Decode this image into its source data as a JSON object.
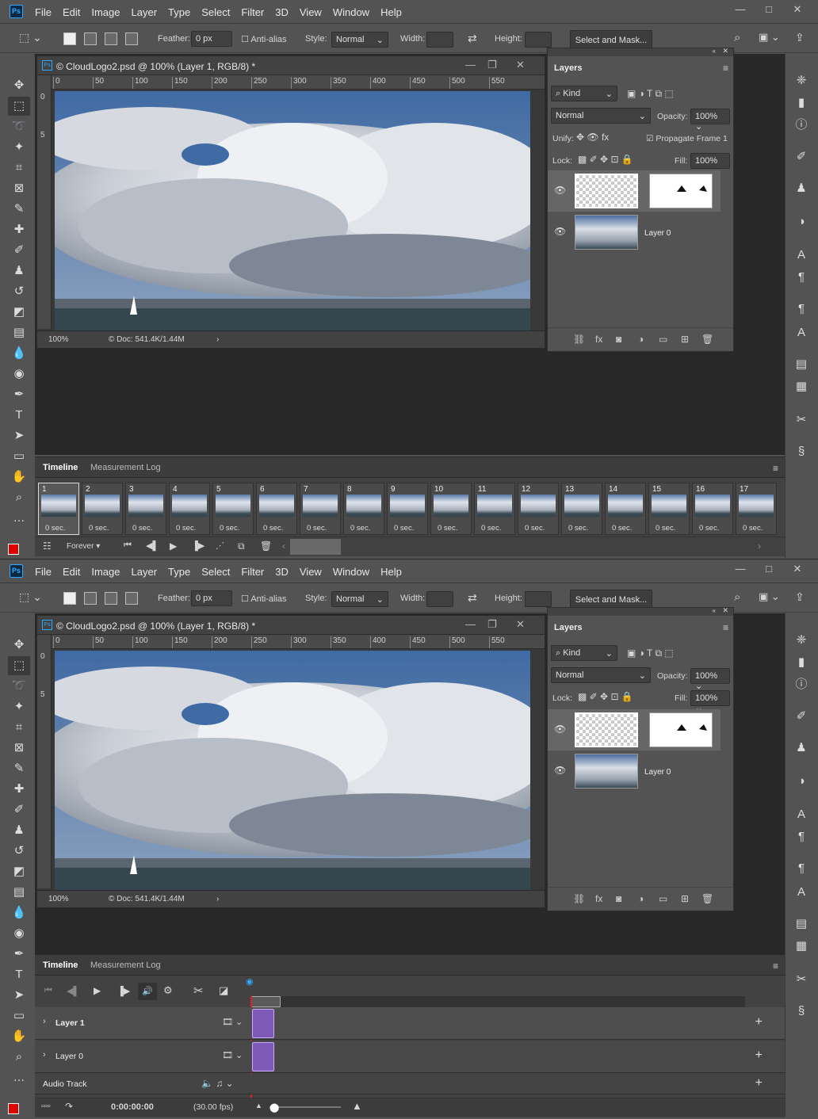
{
  "app": {
    "logo": "Ps",
    "menus": [
      "File",
      "Edit",
      "Image",
      "Layer",
      "Type",
      "Select",
      "Filter",
      "3D",
      "View",
      "Window",
      "Help"
    ],
    "win": [
      "—",
      "□",
      "✕"
    ]
  },
  "options": {
    "feather_label": "Feather:",
    "feather_value": "0 px",
    "antialias": "Anti-alias",
    "style_label": "Style:",
    "style_value": "Normal",
    "width_label": "Width:",
    "height_label": "Height:",
    "select_mask": "Select and Mask..."
  },
  "doc": {
    "title": "© CloudLogo2.psd @ 100% (Layer 1, RGB/8) *",
    "zoom": "100%",
    "info": "© Doc: 541.4K/1.44M",
    "ruler_h": [
      "0",
      "50",
      "100",
      "150",
      "200",
      "250",
      "300",
      "350",
      "400",
      "450",
      "500",
      "550"
    ],
    "ruler_v": [
      "0",
      "5"
    ]
  },
  "layers": {
    "tab": "Layers",
    "kind": "Kind",
    "blend": "Normal",
    "opacity_label": "Opacity:",
    "opacity": "100%",
    "unify": "Unify:",
    "propagate": "Propagate Frame 1",
    "lock": "Lock:",
    "fill_label": "Fill:",
    "fill": "100%",
    "layer0": "Layer 0"
  },
  "timeline": {
    "tab1": "Timeline",
    "tab2": "Measurement Log",
    "frames": [
      "1",
      "2",
      "3",
      "4",
      "5",
      "6",
      "7",
      "8",
      "9",
      "10",
      "11",
      "12",
      "13",
      "14",
      "15",
      "16",
      "17"
    ],
    "frame_delay": "0 sec.",
    "loop": "Forever"
  },
  "timeline2": {
    "rows": [
      "Layer 1",
      "Layer 0"
    ],
    "audio": "Audio Track",
    "time": "0:00:00:00",
    "fps": "(30.00 fps)"
  }
}
